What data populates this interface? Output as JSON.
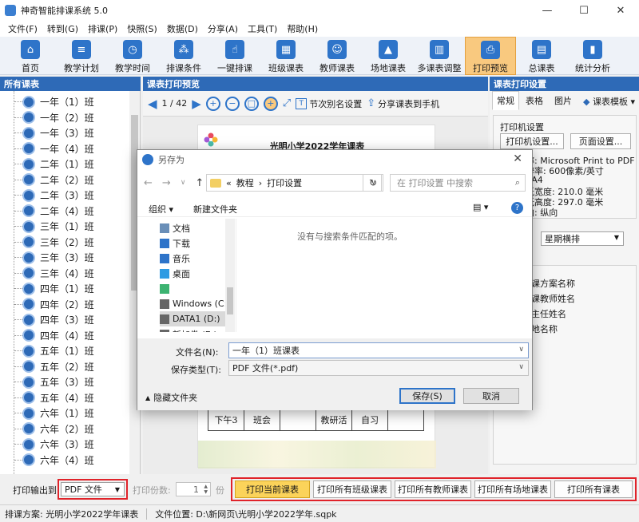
{
  "window": {
    "title": "神奇智能排课系统 5.0"
  },
  "menu": [
    "文件(F)",
    "转到(G)",
    "排课(P)",
    "快照(S)",
    "数据(D)",
    "分享(A)",
    "工具(T)",
    "帮助(H)"
  ],
  "toolbar": [
    {
      "label": "首页",
      "icon": "home-icon",
      "glyph": "⌂"
    },
    {
      "label": "教学计划",
      "icon": "book-icon",
      "glyph": "≡"
    },
    {
      "label": "教学时间",
      "icon": "clock-icon",
      "glyph": "◷"
    },
    {
      "label": "排课条件",
      "icon": "network-icon",
      "glyph": "⁂"
    },
    {
      "label": "一键排课",
      "icon": "hand-icon",
      "glyph": "☝"
    },
    {
      "label": "班级课表",
      "icon": "grid-icon",
      "glyph": "▦"
    },
    {
      "label": "教师课表",
      "icon": "teacher-icon",
      "glyph": "☺"
    },
    {
      "label": "场地课表",
      "icon": "building-icon",
      "glyph": "▲"
    },
    {
      "label": "多课表调整",
      "icon": "adjust-icon",
      "glyph": "▥"
    },
    {
      "label": "打印预览",
      "icon": "printer-icon",
      "glyph": "⎙"
    },
    {
      "label": "总课表",
      "icon": "calendar-icon",
      "glyph": "▤"
    },
    {
      "label": "统计分析",
      "icon": "chart-icon",
      "glyph": "▮"
    }
  ],
  "left": {
    "title": "所有课表",
    "items": [
      "一年（1）班",
      "一年（2）班",
      "一年（3）班",
      "一年（4）班",
      "二年（1）班",
      "二年（2）班",
      "二年（3）班",
      "二年（4）班",
      "三年（1）班",
      "三年（2）班",
      "三年（3）班",
      "三年（4）班",
      "四年（1）班",
      "四年（2）班",
      "四年（3）班",
      "四年（4）班",
      "五年（1）班",
      "五年（2）班",
      "五年（3）班",
      "五年（4）班",
      "六年（1）班",
      "六年（2）班",
      "六年（3）班",
      "六年（4）班"
    ]
  },
  "center": {
    "title": "课表打印预览",
    "page": "1 / 42",
    "alias_btn": "节次别名设置",
    "share_btn": "分享课表到手机",
    "doc_title": "光明小学2022学年课表",
    "row": [
      "下午3",
      "班会",
      "",
      "教研活",
      "自习",
      ""
    ]
  },
  "right": {
    "title": "课表打印设置",
    "tabs": [
      "常规",
      "表格",
      "图片"
    ],
    "template": "课表模板",
    "printer_group": "打印机设置",
    "printer_btn": "打印机设置...",
    "page_btn": "页面设置...",
    "info": [
      "称: Microsoft Print to PDF",
      "辨率: 600像素/英寸",
      ": A4",
      "纸宽度: 210.0 毫米",
      "纸高度: 297.0 毫米",
      "向: 纵向"
    ],
    "layout_value": "星期横排",
    "options": [
      "排课方案名称",
      "任课教师姓名",
      "班主任姓名",
      "场地名称"
    ]
  },
  "bottom": {
    "output_label": "打印输出到:",
    "output_value": "PDF 文件",
    "copies_label": "打印份数:",
    "copies_value": "1",
    "copies_unit": "份",
    "buttons": [
      "打印当前课表",
      "打印所有班级课表",
      "打印所有教师课表",
      "打印所有场地课表",
      "打印所有课表"
    ]
  },
  "status": {
    "scheme": "排课方案: 光明小学2022学年课表",
    "location": "文件位置: D:\\新网页\\光明小学2022学年.sqpk"
  },
  "dialog": {
    "title": "另存为",
    "path_root": "«",
    "path1": "教程",
    "path2": "打印设置",
    "search_placeholder": "在 打印设置 中搜索",
    "organize": "组织 ▾",
    "new_folder": "新建文件夹",
    "sidebar": [
      {
        "label": "文档",
        "icon": "documents-icon",
        "color": "#6a8fb8"
      },
      {
        "label": "下载",
        "icon": "download-icon",
        "color": "#2e74c9"
      },
      {
        "label": "音乐",
        "icon": "music-icon",
        "color": "#2e74c9"
      },
      {
        "label": "桌面",
        "icon": "desktop-icon",
        "color": "#2e9be3"
      },
      {
        "label": "",
        "icon": "app-icon",
        "color": "#3cb371"
      },
      {
        "label": "Windows (C:)",
        "icon": "drive-icon",
        "color": "#666666"
      },
      {
        "label": "DATA1 (D:)",
        "icon": "drive-icon",
        "color": "#666666"
      },
      {
        "label": "新加卷 (E:)",
        "icon": "drive-icon",
        "color": "#666666"
      }
    ],
    "empty_msg": "没有与搜索条件匹配的项。",
    "filename_label": "文件名(N):",
    "filename_value": "一年（1）班课表",
    "type_label": "保存类型(T):",
    "type_value": "PDF 文件(*.pdf)",
    "hide_folders": "隐藏文件夹",
    "save": "保存(S)",
    "cancel": "取消"
  },
  "colors": {
    "accent": "#2e6ab7",
    "highlight": "#fbd35a",
    "alert": "#e0232a"
  }
}
